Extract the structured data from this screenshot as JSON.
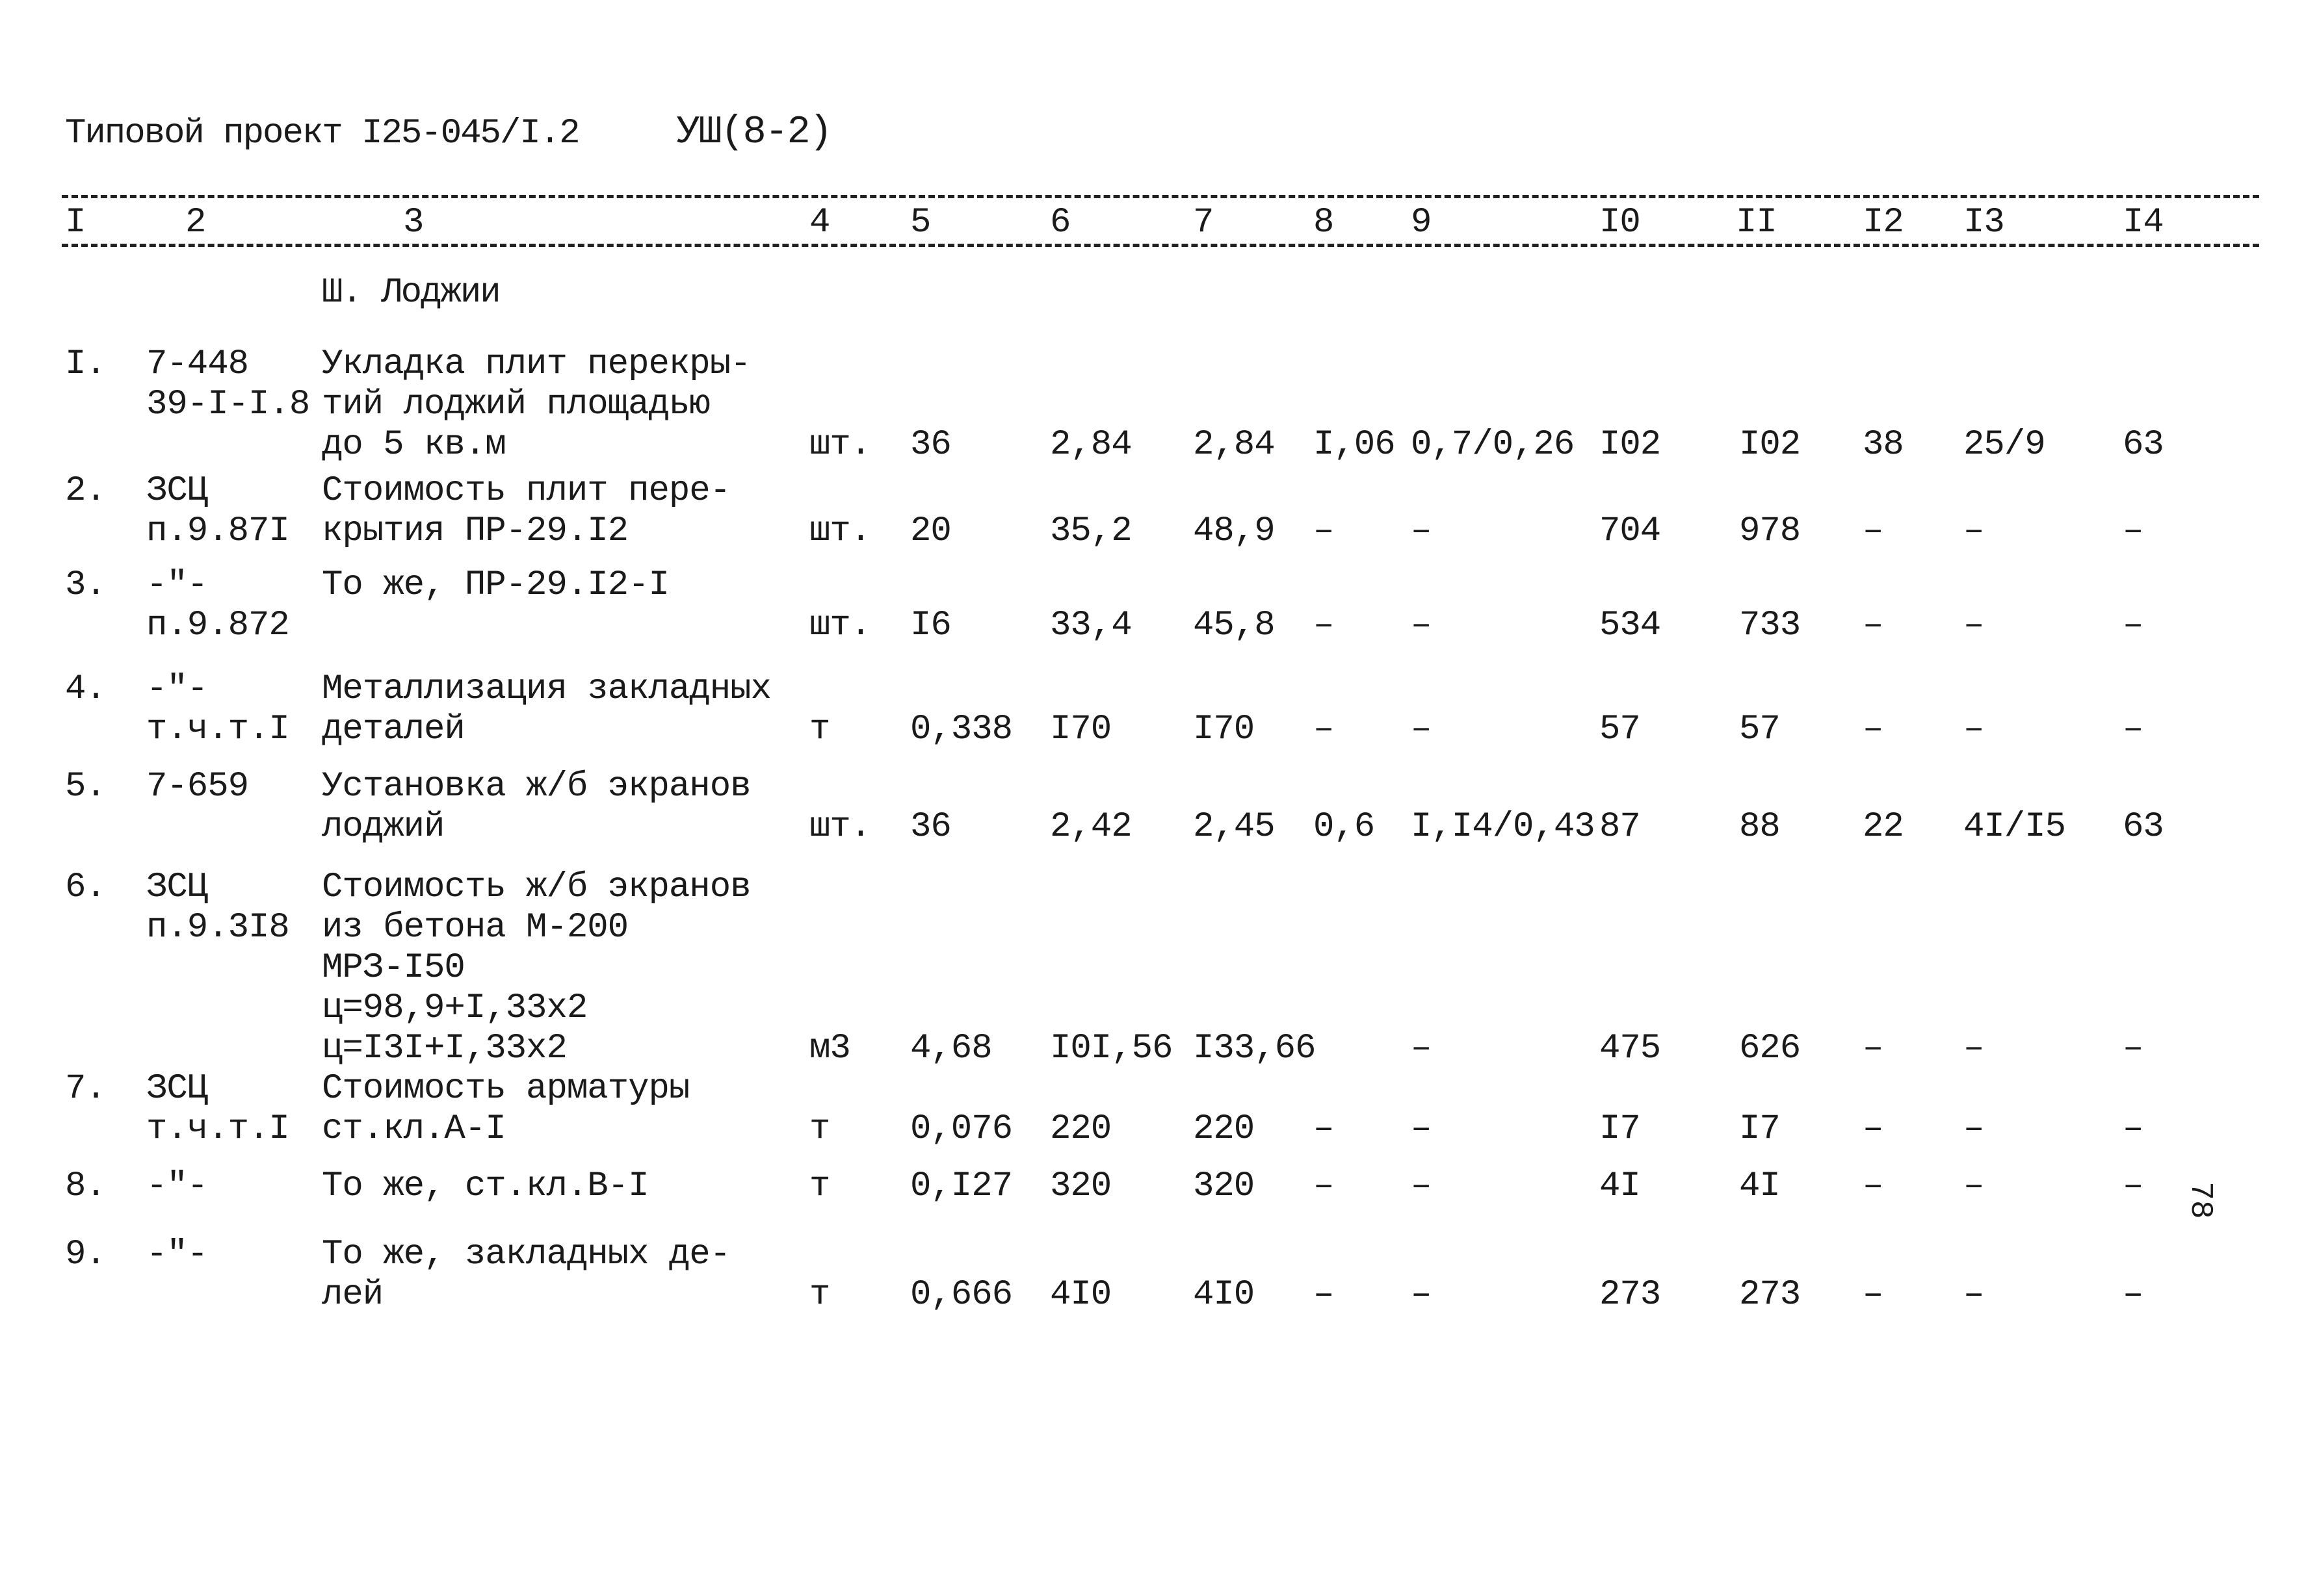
{
  "document": {
    "title": "Типовой проект I25-045/I.2",
    "sheet": "УШ(8-2)",
    "page_mark": "78"
  },
  "header": {
    "columns": [
      "I",
      "2",
      "3",
      "4",
      "5",
      "6",
      "7",
      "8",
      "9",
      "I0",
      "II",
      "I2",
      "I3",
      "I4"
    ]
  },
  "section": {
    "label": "Ш. Лоджии"
  },
  "rows": [
    {
      "n": "I.",
      "code": [
        "7-448",
        "39-I-I.8"
      ],
      "name": [
        "Укладка плит перекры-",
        "тий лоджий площадью",
        "до 5 кв.м"
      ],
      "unit": "шт.",
      "qty": "36",
      "c6": "2,84",
      "c7": "2,84",
      "c8": "I,06",
      "c9": "0,7/0,26",
      "c10": "I02",
      "c11": "I02",
      "c12": "38",
      "c13": "25/9",
      "c14": "63"
    },
    {
      "n": "2.",
      "code": [
        "ЗСЦ",
        "п.9.87I"
      ],
      "name": [
        "Стоимость плит пере-",
        "крытия ПР-29.I2"
      ],
      "unit": "шт.",
      "qty": "20",
      "c6": "35,2",
      "c7": "48,9",
      "c8": "–",
      "c9": "–",
      "c10": "704",
      "c11": "978",
      "c12": "–",
      "c13": "–",
      "c14": "–"
    },
    {
      "n": "3.",
      "code": [
        "-\"-",
        "п.9.872"
      ],
      "name": [
        "То же, ПР-29.I2-I"
      ],
      "unit": "шт.",
      "qty": "I6",
      "c6": "33,4",
      "c7": "45,8",
      "c8": "–",
      "c9": "–",
      "c10": "534",
      "c11": "733",
      "c12": "–",
      "c13": "–",
      "c14": "–"
    },
    {
      "n": "4.",
      "code": [
        "-\"-",
        "т.ч.т.I"
      ],
      "name": [
        "Металлизация закладных",
        "деталей"
      ],
      "unit": "т",
      "qty": "0,338",
      "c6": "I70",
      "c7": "I70",
      "c8": "–",
      "c9": "–",
      "c10": "57",
      "c11": "57",
      "c12": "–",
      "c13": "–",
      "c14": "–"
    },
    {
      "n": "5.",
      "code": [
        "7-659"
      ],
      "name": [
        "Установка ж/б экранов",
        "лоджий"
      ],
      "unit": "шт.",
      "qty": "36",
      "c6": "2,42",
      "c7": "2,45",
      "c8": "0,6",
      "c9": "I,I4/0,43",
      "c10": "87",
      "c11": "88",
      "c12": "22",
      "c13": "4I/I5",
      "c14": "63"
    },
    {
      "n": "6.",
      "code": [
        "ЗСЦ",
        "п.9.3I8"
      ],
      "name": [
        "Стоимость ж/б экранов",
        "из бетона М-200",
        "МРЗ-I50",
        "ц=98,9+I,33х2",
        "ц=I3I+I,33х2"
      ],
      "unit": "м3",
      "qty": "4,68",
      "c6": "I0I,56",
      "c7": "I33,66",
      "c8": "",
      "c9": "–",
      "c10": "475",
      "c11": "626",
      "c12": "–",
      "c13": "–",
      "c14": "–"
    },
    {
      "n": "7.",
      "code": [
        "ЗСЦ",
        "т.ч.т.I"
      ],
      "name": [
        "Стоимость арматуры",
        "ст.кл.А-I"
      ],
      "unit": "т",
      "qty": "0,076",
      "c6": "220",
      "c7": "220",
      "c8": "–",
      "c9": "–",
      "c10": "I7",
      "c11": "I7",
      "c12": "–",
      "c13": "–",
      "c14": "–"
    },
    {
      "n": "8.",
      "code": [
        "-\"-"
      ],
      "name": [
        "То же, ст.кл.В-I"
      ],
      "unit": "т",
      "qty": "0,I27",
      "c6": "320",
      "c7": "320",
      "c8": "–",
      "c9": "–",
      "c10": "4I",
      "c11": "4I",
      "c12": "–",
      "c13": "–",
      "c14": "–"
    },
    {
      "n": "9.",
      "code": [
        "-\"-"
      ],
      "name": [
        "То же, закладных де-",
        "лей"
      ],
      "unit": "т",
      "qty": "0,666",
      "c6": "4I0",
      "c7": "4I0",
      "c8": "–",
      "c9": "–",
      "c10": "273",
      "c11": "273",
      "c12": "–",
      "c13": "–",
      "c14": "–"
    }
  ]
}
